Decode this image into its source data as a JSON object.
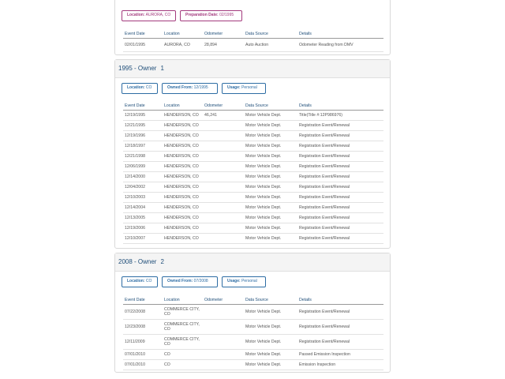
{
  "top": {
    "location_label": "Location:",
    "location_value": "AURORA, CO",
    "prep_label": "Preparation Date:",
    "prep_value": "02/1995",
    "headers": [
      "Event Date",
      "Location",
      "Odometer",
      "Data Source",
      "Details"
    ],
    "rows": [
      [
        "02/01/1995",
        "AURORA, CO",
        "28,894",
        "Auto Auction",
        "Odometer Reading from DMV"
      ]
    ]
  },
  "owner1": {
    "year": "1995 - Owner",
    "num": "1",
    "location_label": "Location:",
    "location_value": "CO",
    "owned_label": "Owned From:",
    "owned_value": "12/1995",
    "usage_label": "Usage:",
    "usage_value": "Personal",
    "headers": [
      "Event Date",
      "Location",
      "Odometer",
      "Data Source",
      "Details"
    ],
    "rows": [
      [
        "12/19/1995",
        "HENDERSON, CO",
        "46,241",
        "Motor Vehicle Dept.",
        "Title(Title #:12P986976)"
      ],
      [
        "12/21/1995",
        "HENDERSON, CO",
        "",
        "Motor Vehicle Dept.",
        "Registration Event/Renewal"
      ],
      [
        "12/19/1996",
        "HENDERSON, CO",
        "",
        "Motor Vehicle Dept.",
        "Registration Event/Renewal"
      ],
      [
        "12/18/1997",
        "HENDERSON, CO",
        "",
        "Motor Vehicle Dept.",
        "Registration Event/Renewal"
      ],
      [
        "12/21/1998",
        "HENDERSON, CO",
        "",
        "Motor Vehicle Dept.",
        "Registration Event/Renewal"
      ],
      [
        "12/06/1999",
        "HENDERSON, CO",
        "",
        "Motor Vehicle Dept.",
        "Registration Event/Renewal"
      ],
      [
        "12/14/2000",
        "HENDERSON, CO",
        "",
        "Motor Vehicle Dept.",
        "Registration Event/Renewal"
      ],
      [
        "12/04/2002",
        "HENDERSON, CO",
        "",
        "Motor Vehicle Dept.",
        "Registration Event/Renewal"
      ],
      [
        "12/10/2003",
        "HENDERSON, CO",
        "",
        "Motor Vehicle Dept.",
        "Registration Event/Renewal"
      ],
      [
        "12/14/2004",
        "HENDERSON, CO",
        "",
        "Motor Vehicle Dept.",
        "Registration Event/Renewal"
      ],
      [
        "12/13/2005",
        "HENDERSON, CO",
        "",
        "Motor Vehicle Dept.",
        "Registration Event/Renewal"
      ],
      [
        "12/19/2006",
        "HENDERSON, CO",
        "",
        "Motor Vehicle Dept.",
        "Registration Event/Renewal"
      ],
      [
        "12/10/2007",
        "HENDERSON, CO",
        "",
        "Motor Vehicle Dept.",
        "Registration Event/Renewal"
      ]
    ]
  },
  "owner2": {
    "year": "2008 - Owner",
    "num": "2",
    "location_label": "Location:",
    "location_value": "CO",
    "owned_label": "Owned From:",
    "owned_value": "07/2008",
    "usage_label": "Usage:",
    "usage_value": "Personal",
    "headers": [
      "Event Date",
      "Location",
      "Odometer",
      "Data Source",
      "Details"
    ],
    "rows": [
      [
        "07/22/2008",
        "COMMERCE CITY, CO",
        "",
        "Motor Vehicle Dept.",
        "Registration Event/Renewal"
      ],
      [
        "12/23/2008",
        "COMMERCE CITY, CO",
        "",
        "Motor Vehicle Dept.",
        "Registration Event/Renewal"
      ],
      [
        "12/11/2009",
        "COMMERCE CITY, CO",
        "",
        "Motor Vehicle Dept.",
        "Registration Event/Renewal"
      ],
      [
        "07/01/2010",
        "CO",
        "",
        "Motor Vehicle Dept.",
        "Passed Emission Inspection"
      ],
      [
        "07/01/2010",
        "CO",
        "",
        "Motor Vehicle Dept.",
        "Emission Inspection"
      ]
    ]
  }
}
